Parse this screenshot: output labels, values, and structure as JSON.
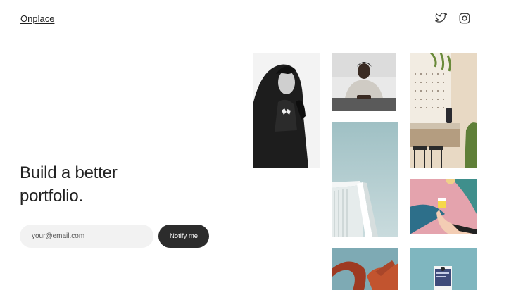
{
  "header": {
    "brand": "Onplace",
    "social": [
      {
        "icon": "twitter-icon"
      },
      {
        "icon": "instagram-icon"
      }
    ]
  },
  "hero": {
    "headline_line1": "Build a better",
    "headline_line2": "portfolio."
  },
  "signup": {
    "email_placeholder": "your@email.com",
    "button_label": "Notify me"
  },
  "gallery": {
    "tiles": [
      {
        "name": "photo-man-hoodie",
        "subject": "man in black hoodie"
      },
      {
        "name": "photo-man-desk",
        "subject": "man at desk"
      },
      {
        "name": "photo-architecture",
        "subject": "white building against sky"
      },
      {
        "name": "photo-red-sculpture",
        "subject": "red sculpture"
      },
      {
        "name": "photo-cafe-interior",
        "subject": "cafe interior with stools"
      },
      {
        "name": "photo-coffee-cup",
        "subject": "hand holding yellow cup against pink wall"
      },
      {
        "name": "photo-book",
        "subject": "person holding book"
      }
    ]
  },
  "colors": {
    "text": "#222222",
    "button_bg": "#2c2c2c",
    "input_bg": "#f2f2f2"
  }
}
